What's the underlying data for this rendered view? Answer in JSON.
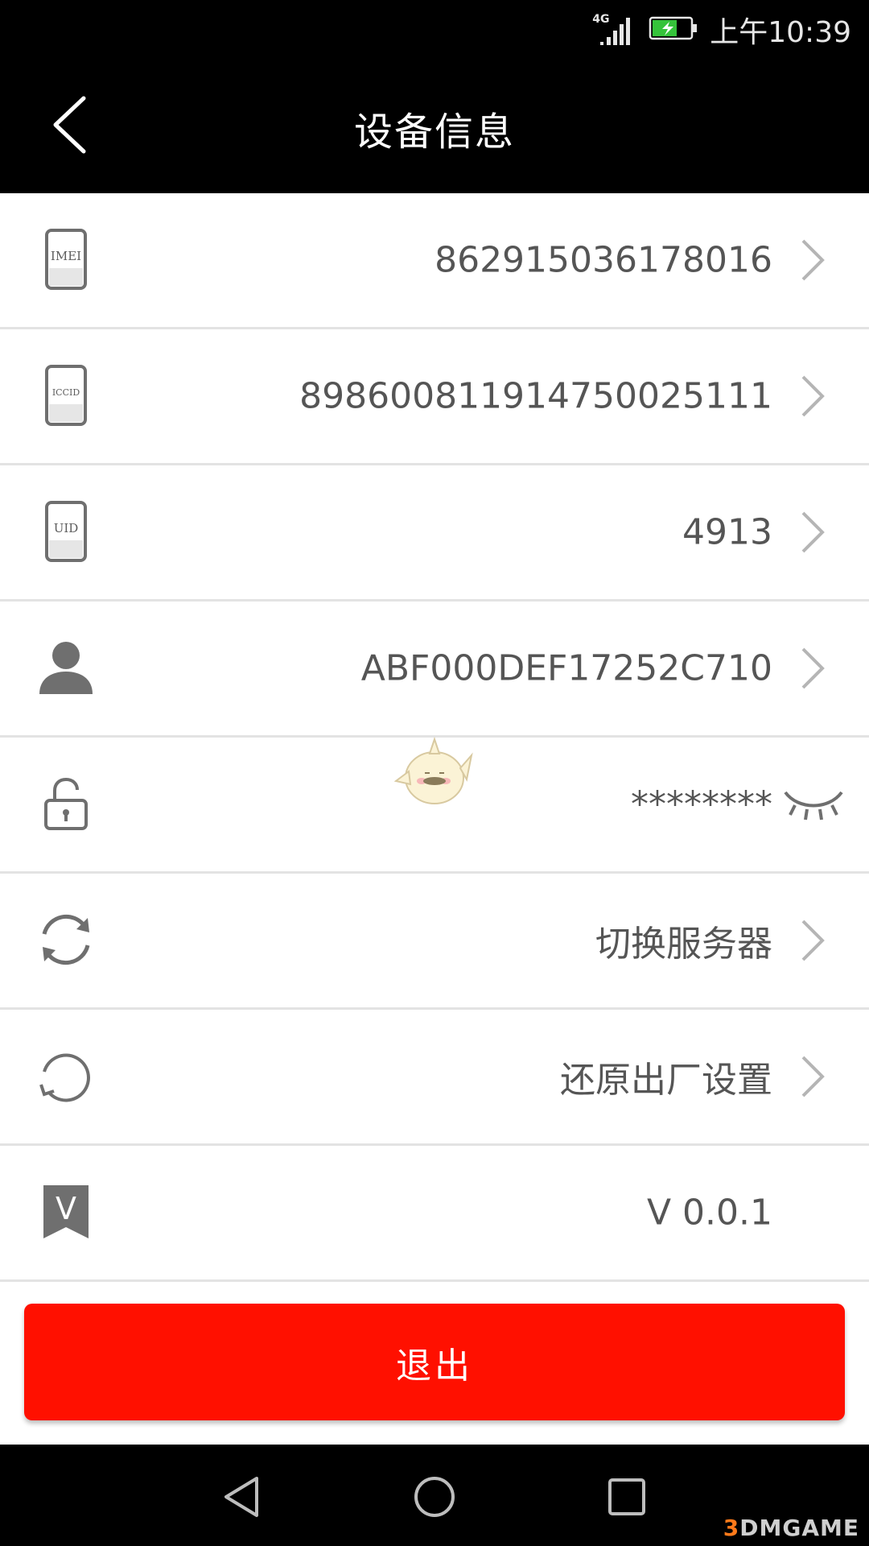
{
  "status_bar": {
    "network": "4G",
    "time": "上午10:39"
  },
  "header": {
    "title": "设备信息"
  },
  "rows": [
    {
      "icon": "imei-card-icon",
      "icon_label": "IMEI",
      "value": "862915036178016",
      "has_chevron": true
    },
    {
      "icon": "iccid-card-icon",
      "icon_label": "ICCID",
      "value": "898600811914750025111",
      "has_chevron": true
    },
    {
      "icon": "uid-card-icon",
      "icon_label": "UID",
      "value": "4913",
      "has_chevron": true
    },
    {
      "icon": "person-icon",
      "value": "ABF000DEF17252C710",
      "has_chevron": true
    },
    {
      "icon": "unlocked-padlock-icon",
      "value": "********",
      "has_chevron": false
    },
    {
      "icon": "switch-server-icon",
      "value": "切换服务器",
      "has_chevron": true
    },
    {
      "icon": "factory-reset-icon",
      "value": "还原出厂设置",
      "has_chevron": true
    },
    {
      "icon": "version-ribbon-icon",
      "icon_label": "V",
      "value": "V 0.0.1",
      "has_chevron": false
    }
  ],
  "logout": {
    "label": "退出"
  },
  "watermark": {
    "prefix": "3",
    "text": "DMGAME"
  },
  "colors": {
    "header_bg": "#000000",
    "logout_bg": "#ff1000",
    "icon_gray": "#6f6f6f",
    "value_gray": "#555555"
  }
}
